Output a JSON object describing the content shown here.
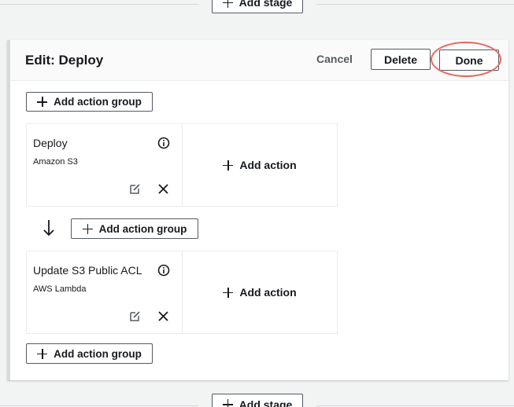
{
  "top_add_stage_label": "Add stage",
  "bottom_add_stage_label": "Add stage",
  "panel": {
    "title": "Edit: Deploy",
    "cancel_label": "Cancel",
    "delete_label": "Delete",
    "done_label": "Done"
  },
  "add_action_group_label_1": "Add action group",
  "add_action_group_label_2": "Add action group",
  "add_action_group_label_3": "Add action group",
  "groups": [
    {
      "action_name": "Deploy",
      "provider": "Amazon S3",
      "add_action_label": "Add action"
    },
    {
      "action_name": "Update S3 Public ACL",
      "provider": "AWS Lambda",
      "add_action_label": "Add action"
    }
  ],
  "colors": {
    "highlight": "#e8685e",
    "border": "#545b64",
    "background": "#f2f3f3"
  },
  "icons": [
    "plus-icon",
    "info-icon",
    "edit-icon",
    "close-icon",
    "arrow-down-icon"
  ]
}
